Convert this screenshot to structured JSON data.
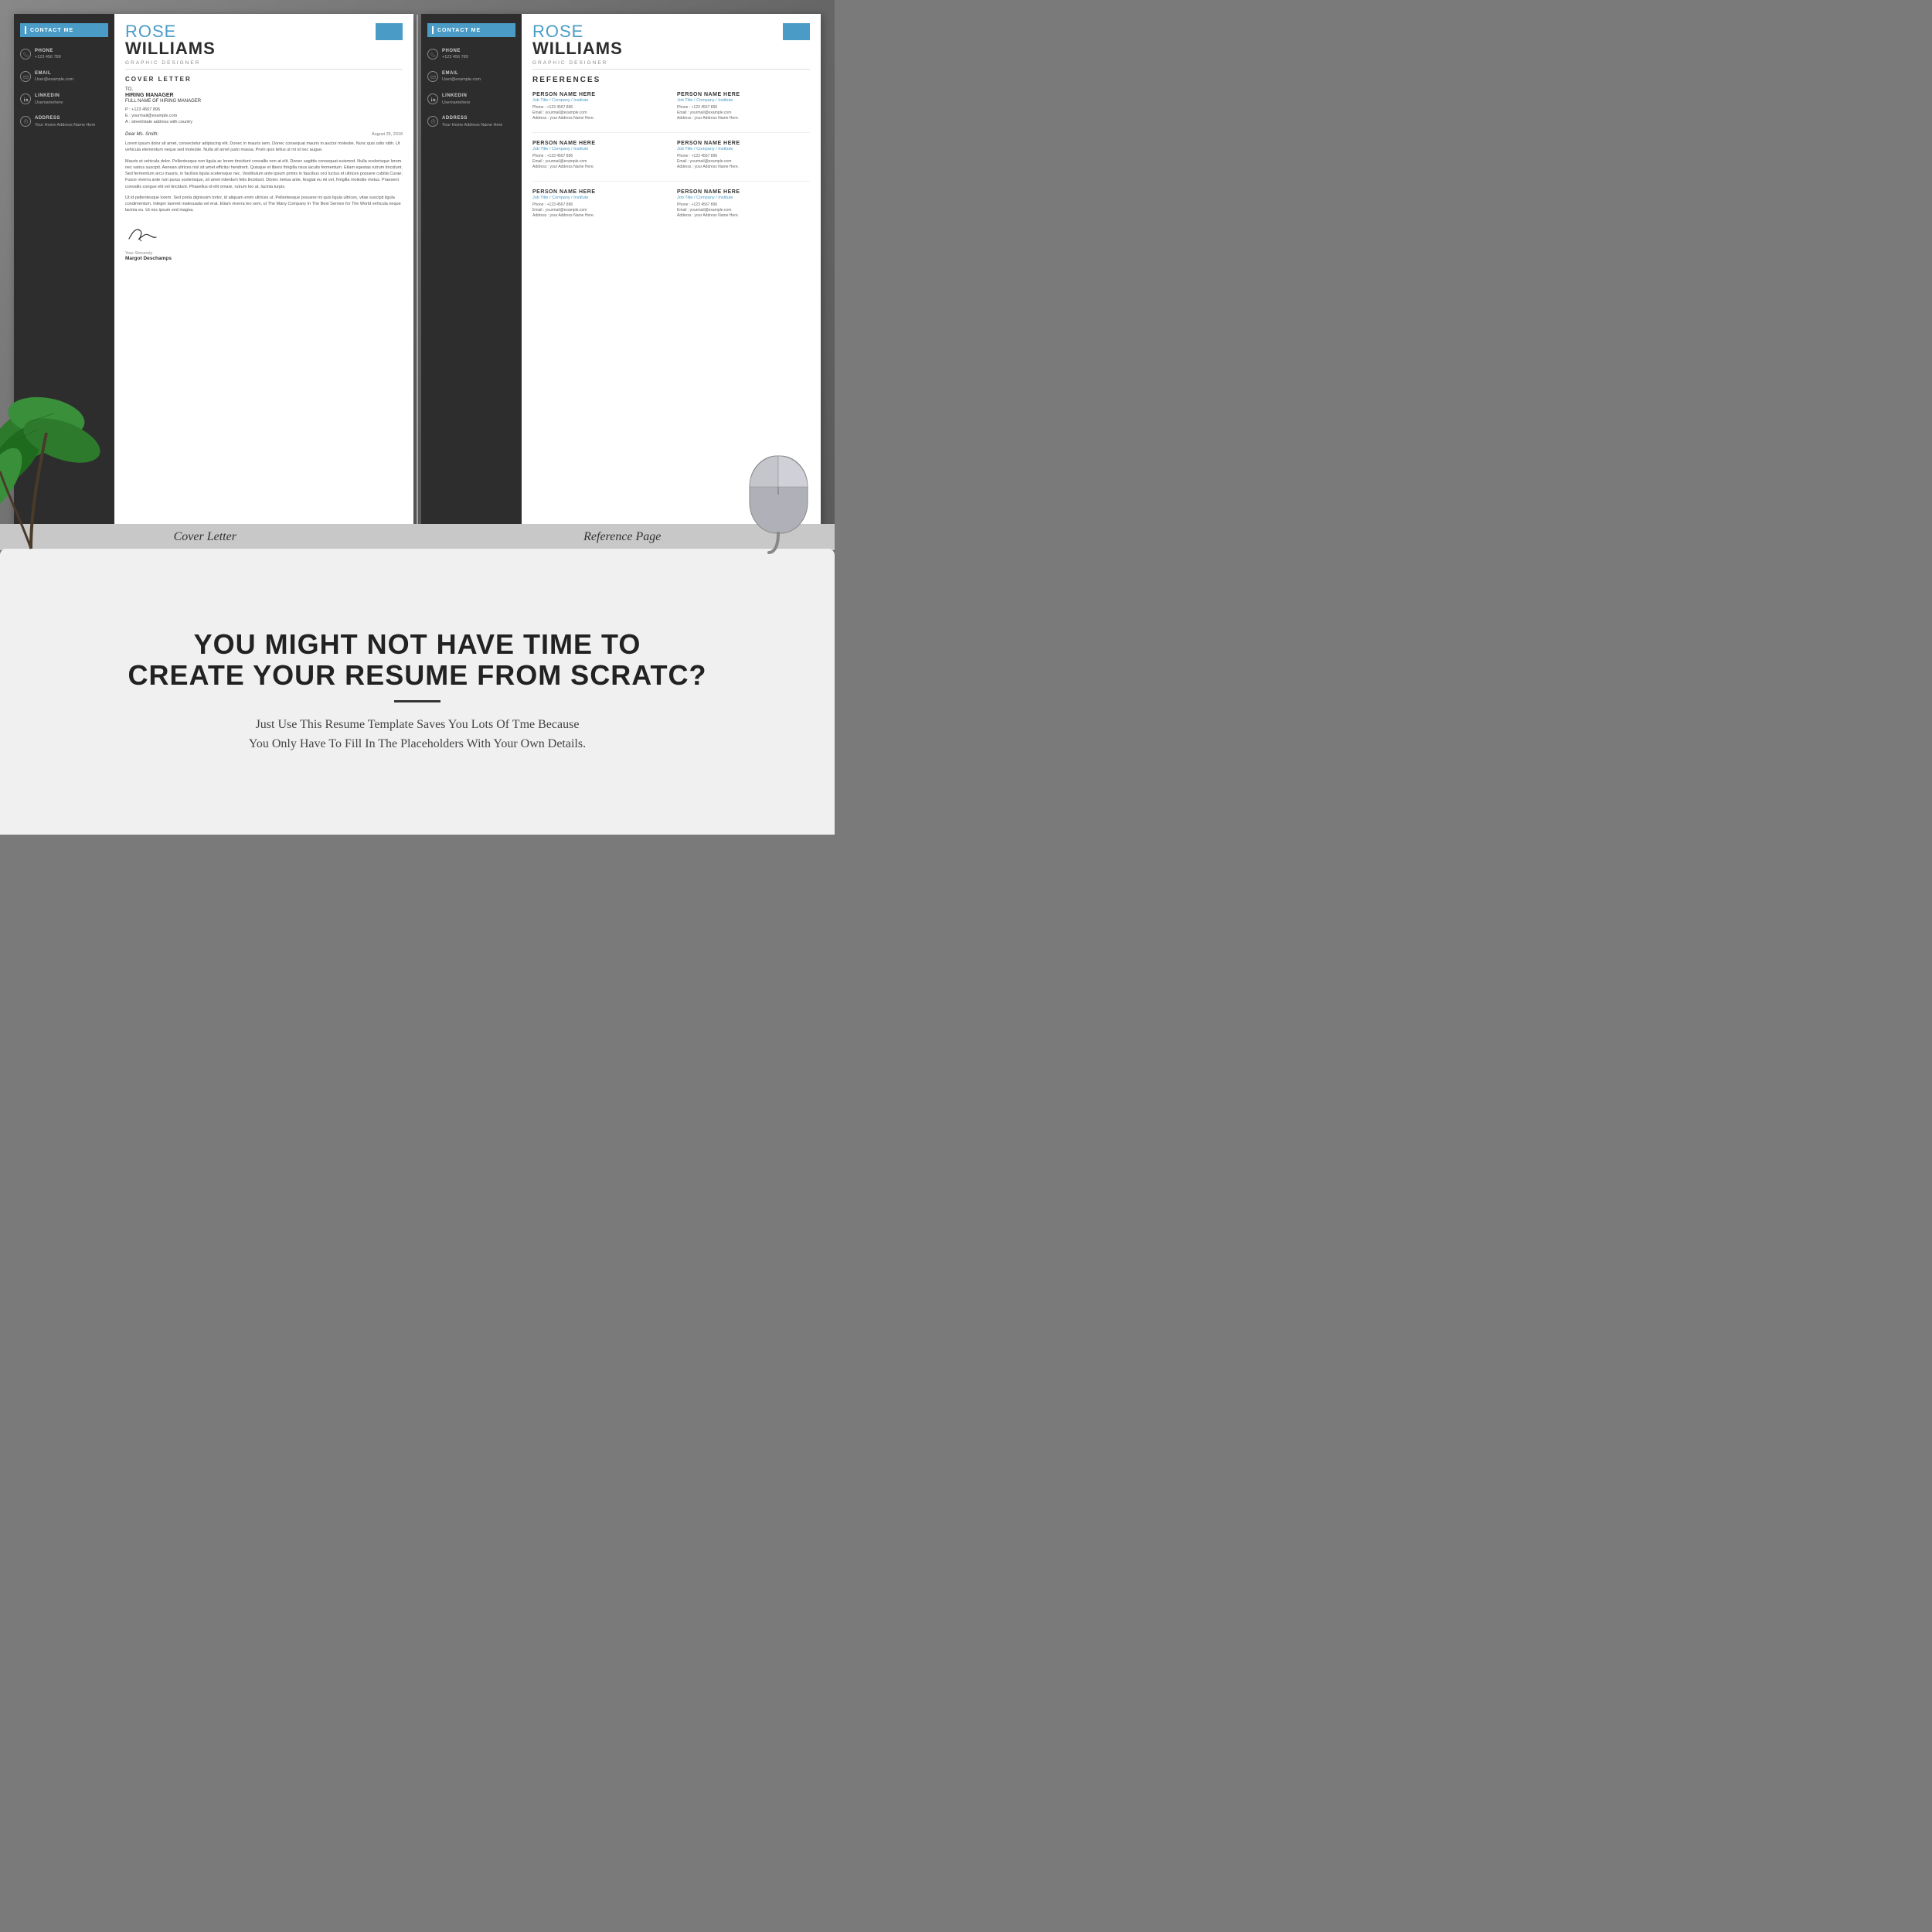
{
  "page": {
    "background_color": "#7a7a7a"
  },
  "labels_bar": {
    "cover_letter": "Cover Letter",
    "reference_page": "Reference Page"
  },
  "left_preview": {
    "sidebar": {
      "contact_me_label": "CONTACT ME",
      "items": [
        {
          "label": "PHONE",
          "value": "+123 456 789",
          "icon": "phone"
        },
        {
          "label": "EMAIL",
          "value": "User@example.com",
          "icon": "email"
        },
        {
          "label": "LINKEDIN",
          "value": "Usernamehere",
          "icon": "linkedin"
        },
        {
          "label": "ADDRESS",
          "value": "Your Home Address Name Here",
          "icon": "address"
        }
      ]
    },
    "header": {
      "first_name": "ROSE",
      "last_name": "WILLIAMS",
      "job_title": "GRAPHIC DESIGNER"
    },
    "cover_letter": {
      "section_title": "COVER LETTER",
      "to": "TO,",
      "manager": "HIRING MANAGER",
      "fullname": "FULL NAME OF HIRING MANAGER",
      "phone_line": "P   :   +123 4567 896",
      "email_line": "E   :   yourmail@example.com",
      "address_line": "A   :   street/state address with country",
      "dear_line": "Dear Ms. Smith:",
      "date": "August 25, 2018",
      "body1": "Lorem ipsum dolor sit amet, consectetur adipiscing elit. Donec in mauris sem. Donec consequat mauris in auctor molestie. Nunc quis odio nibh. Ut vehicula elementum neque sed molestie. Nulla sit arnet justo massa. Proin quis tellus ut mi id nec augue.",
      "body2": "Mauris et vehicula dolor. Pellentesque non ligula ac lorem tincidunt convallis non at elit. Donec sagittis consequat euismod. Nulla scelerisque lorem nec varius suscipit. Aenean ultrices nisl sit amet efficitur hendrerit. Quisque et libero fringilla risus iaculis fermentum. Etiam egestas rutrum tincidunt. Sed fermentum arcu mauris, in facilisis ligula scelerisque nec. Vestibulum ante ipsum primis in faucibus orci luctus et ultrices posuere cubilia Curae; Fusce viverra ante non purus scelerisque, sit amet interdum felis tincidunt. Donec metus ante, feugiat eu mi vel, fringilla molestie metus. Praesent convallis congue elit vel tincidunt. Phasellus id elit ornare, rutrum leo at, lacinia turpis.",
      "body3": "Ut id pellentesque lorem. Sed porta dignissim tortor, id aliquam enim ultrices ut. Pellentesque posuere mi quis ligula ultrices, vitae suscipit ligula condimentum. Integer laoreet malesuada vel erat. Etiam viverra leo sem, ut The Many Company In The Best Service for The World vehicula neque lacinia eu. Ut nec ipsum sed magna.",
      "yours_sincerely": "Your Sincerely",
      "signer_name": "Margot Deschamps"
    }
  },
  "right_preview": {
    "sidebar": {
      "contact_me_label": "CONTACT ME",
      "items": [
        {
          "label": "PHONE",
          "value": "+123 456 789",
          "icon": "phone"
        },
        {
          "label": "EMAIL",
          "value": "User@example.com",
          "icon": "email"
        },
        {
          "label": "LINKEDIN",
          "value": "Usernamehere",
          "icon": "linkedin"
        },
        {
          "label": "ADDRESS",
          "value": "Your Home Address Name Here",
          "icon": "address"
        }
      ]
    },
    "header": {
      "first_name": "ROSE",
      "last_name": "WILLIAMS",
      "job_title": "GRAPHIC DESIGNER"
    },
    "references": {
      "section_title": "REFERENCES",
      "persons": [
        {
          "name": "PERSON NAME HERE",
          "jobtitle": "Job Title / Company / Institute",
          "phone": "Phone : +123 4567 896",
          "email": "Email : yourmail@example.com",
          "address": "Address : your Address Name Here."
        },
        {
          "name": "PERSON NAME HERE",
          "jobtitle": "Job Title / Company / Institute",
          "phone": "Phone : +123 4567 896",
          "email": "Email : yourmail@example.com",
          "address": "Address : your Address Name Here."
        },
        {
          "name": "PERSON NAME HERE",
          "jobtitle": "Job Title / Company / Institute",
          "phone": "Phone : +123 4567 896",
          "email": "Email : yourmail@example.com",
          "address": "Address : your Address Name Here."
        },
        {
          "name": "PERSON NAME HERE",
          "jobtitle": "Job Title / Company / Institute",
          "phone": "Phone : +123 4567 896",
          "email": "Email : yourmail@example.com",
          "address": "Address : your Address Name Here."
        },
        {
          "name": "PERSON NAME HERE",
          "jobtitle": "Job Title / Company / Institute",
          "phone": "Phone : +123 4567 896",
          "email": "Email : yourmail@example.com",
          "address": "Address : your Address Name Here."
        },
        {
          "name": "PERSON NAME HERE",
          "jobtitle": "Job Title / Company / Institute",
          "phone": "Phone : +123 4567 896",
          "email": "Email : yourmail@example.com",
          "address": "Address : your Address Name Here."
        }
      ]
    }
  },
  "bottom": {
    "headline_line1": "YOU MIGHT NOT HAVE TIME TO",
    "headline_line2": "CREATE YOUR RESUME FROM SCRATC?",
    "subtext_line1": "Just Use This Resume Template Saves You Lots Of Tme Because",
    "subtext_line2": "You Only Have To Fill In The Placeholders With Your Own Details."
  }
}
